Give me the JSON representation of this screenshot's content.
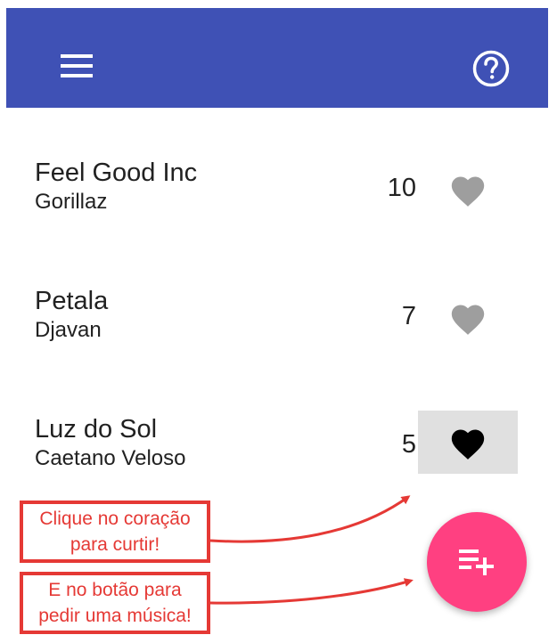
{
  "appbar": {
    "background": "#3f51b5",
    "menu_icon": "menu-icon",
    "help_icon": "help-circle-icon"
  },
  "songs": [
    {
      "title": "Feel Good Inc",
      "artist": "Gorillaz",
      "votes": "10",
      "liked": false
    },
    {
      "title": "Petala",
      "artist": "Djavan",
      "votes": "7",
      "liked": false
    },
    {
      "title": "Luz do Sol",
      "artist": "Caetano Veloso",
      "votes": "5",
      "liked": true
    }
  ],
  "fab": {
    "icon": "playlist-add-icon",
    "color": "#ff4081"
  },
  "annotations": {
    "like_hint": "Clique no coração\npara curtir!",
    "request_hint": "E no botão para\npedir uma música!",
    "color": "#e53935"
  }
}
